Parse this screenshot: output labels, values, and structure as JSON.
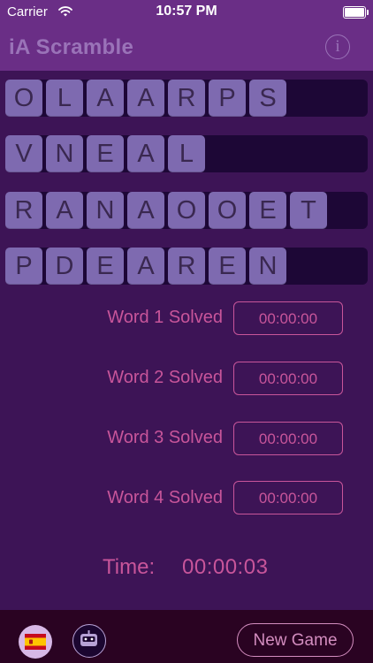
{
  "status_bar": {
    "carrier": "Carrier",
    "time": "10:57 PM",
    "wifi_icon": "wifi-icon",
    "battery_icon": "battery-icon"
  },
  "nav": {
    "title": "iA Scramble",
    "info_glyph": "i",
    "info_icon": "info-icon"
  },
  "words": [
    {
      "letters": [
        "O",
        "L",
        "A",
        "A",
        "R",
        "P",
        "S"
      ]
    },
    {
      "letters": [
        "V",
        "N",
        "E",
        "A",
        "L"
      ]
    },
    {
      "letters": [
        "R",
        "A",
        "N",
        "A",
        "O",
        "O",
        "E",
        "T"
      ]
    },
    {
      "letters": [
        "P",
        "D",
        "E",
        "A",
        "R",
        "E",
        "N"
      ]
    }
  ],
  "solved": [
    {
      "label": "Word 1 Solved",
      "time": "00:00:00"
    },
    {
      "label": "Word 2 Solved",
      "time": "00:00:00"
    },
    {
      "label": "Word 3 Solved",
      "time": "00:00:00"
    },
    {
      "label": "Word 4 Solved",
      "time": "00:00:00"
    }
  ],
  "timer": {
    "label": "Time:",
    "value": "00:00:03"
  },
  "bottom": {
    "language_flag_icon": "spain-flag-icon",
    "robot_icon": "robot-icon",
    "new_game_label": "New Game"
  },
  "colors": {
    "background": "#3d1456",
    "header": "#6a2e86",
    "tile": "#7e6ab0",
    "accent": "#c8559a",
    "bottom_bar": "#2a0322"
  }
}
